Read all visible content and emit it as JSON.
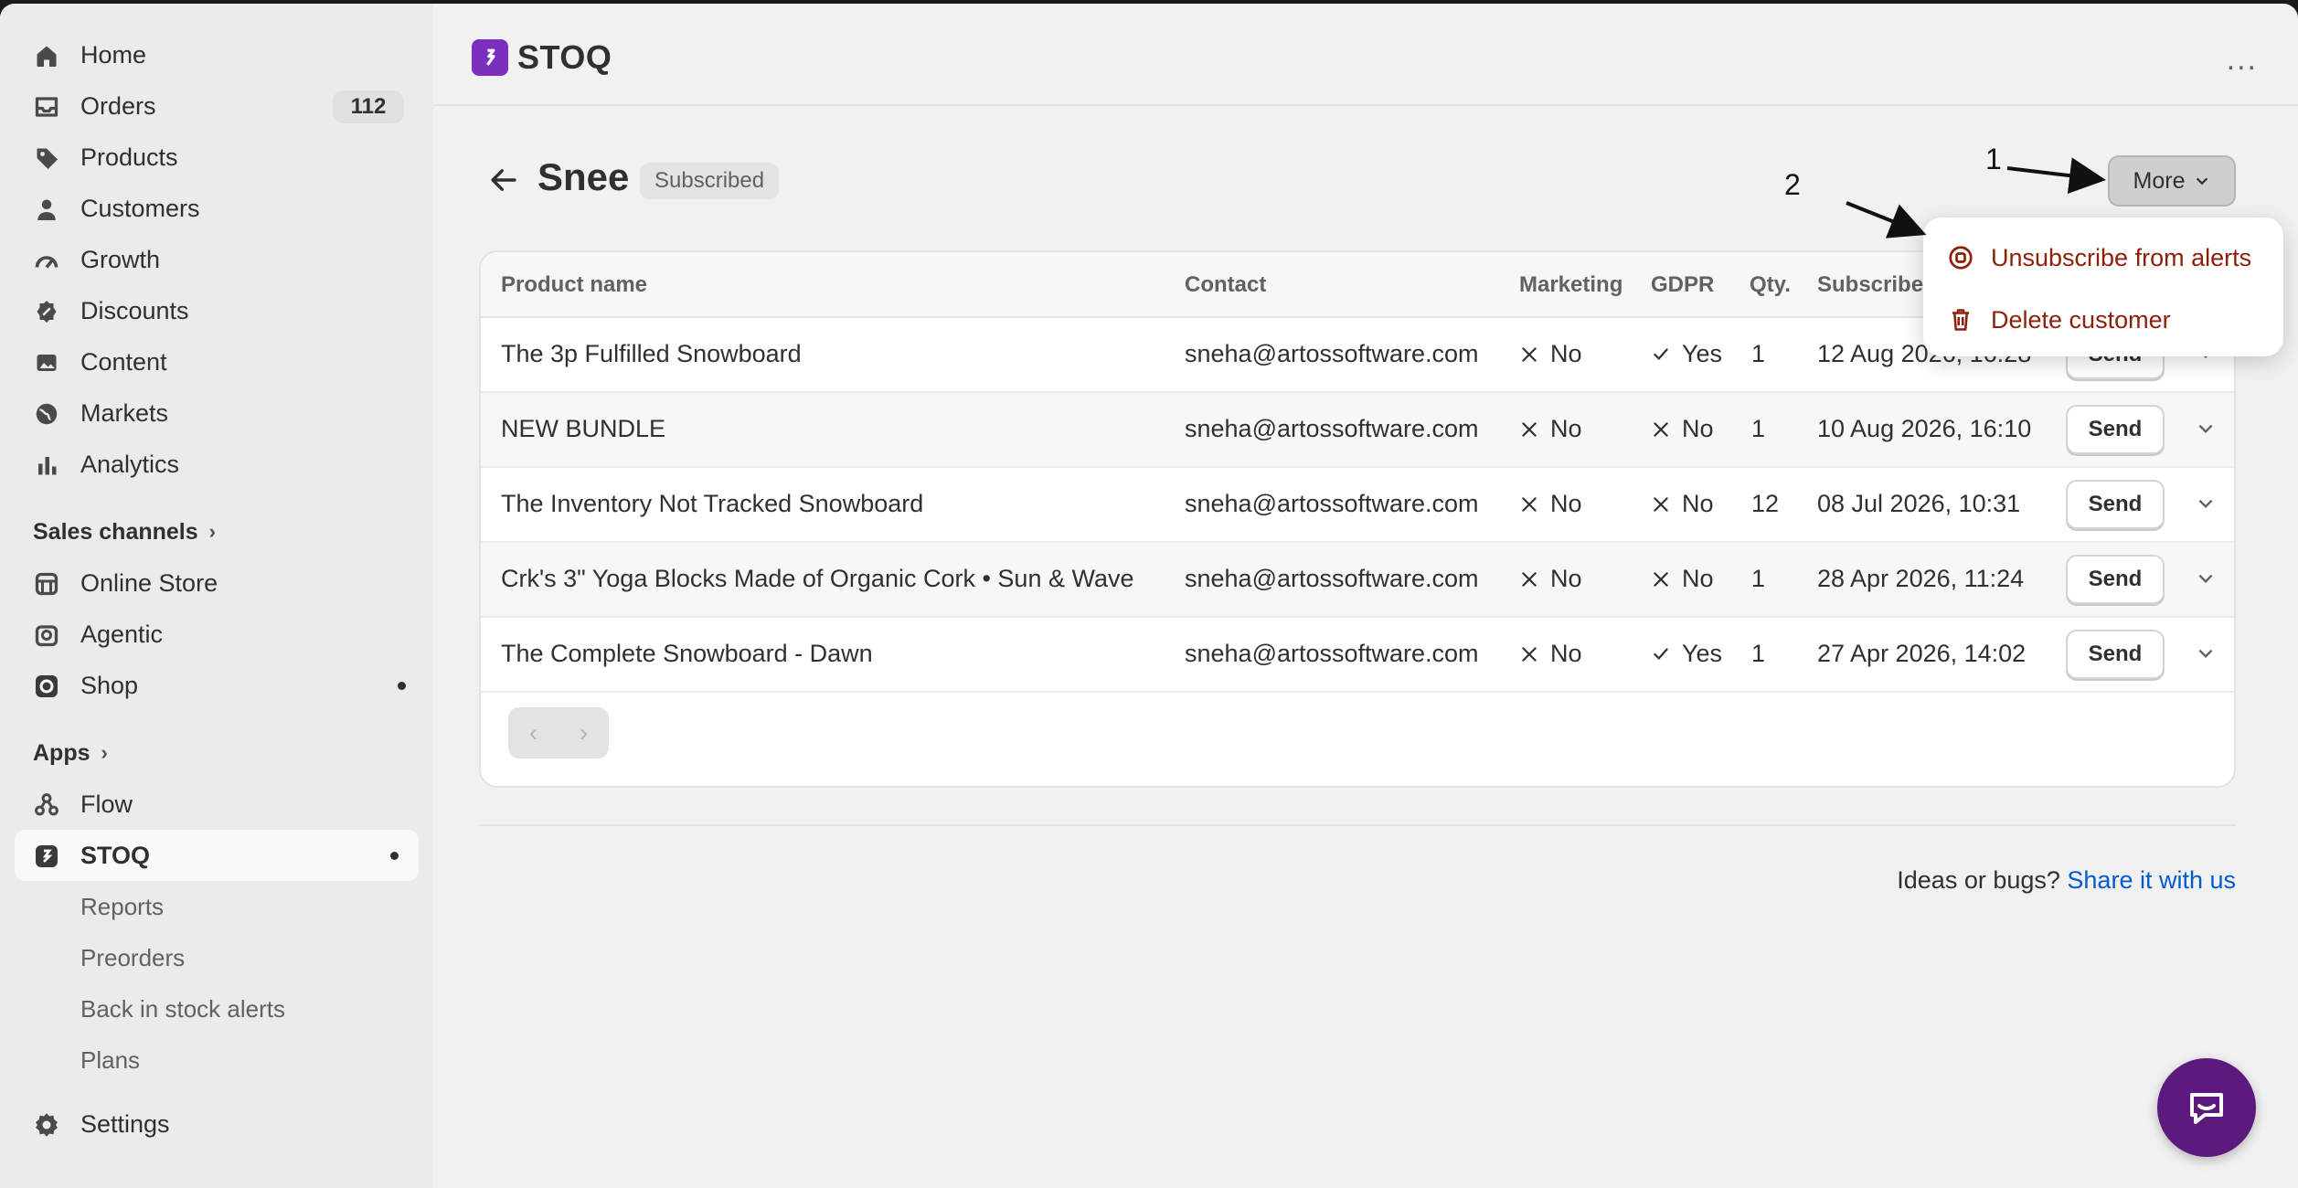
{
  "sidebar": {
    "main_items": [
      {
        "label": "Home",
        "icon": "home-icon"
      },
      {
        "label": "Orders",
        "icon": "inbox-icon",
        "badge": "112"
      },
      {
        "label": "Products",
        "icon": "tag-icon"
      },
      {
        "label": "Customers",
        "icon": "person-icon"
      },
      {
        "label": "Growth",
        "icon": "gauge-icon"
      },
      {
        "label": "Discounts",
        "icon": "discount-icon"
      },
      {
        "label": "Content",
        "icon": "image-icon"
      },
      {
        "label": "Markets",
        "icon": "globe-icon"
      },
      {
        "label": "Analytics",
        "icon": "bar-chart-icon"
      }
    ],
    "sales_channels_label": "Sales channels",
    "channels": [
      {
        "label": "Online Store",
        "icon": "store-icon"
      },
      {
        "label": "Agentic",
        "icon": "robot-icon"
      },
      {
        "label": "Shop",
        "icon": "shop-icon"
      }
    ],
    "apps_label": "Apps",
    "apps": [
      {
        "label": "Flow",
        "icon": "flow-icon"
      },
      {
        "label": "STOQ",
        "icon": "stoq-icon"
      }
    ],
    "stoq_subitems": [
      "Reports",
      "Preorders",
      "Back in stock alerts",
      "Plans"
    ],
    "settings_label": "Settings"
  },
  "topbar": {
    "brand": "STOQ",
    "more": "..."
  },
  "header": {
    "title": "Snee",
    "status_badge": "Subscribed",
    "more_button": "More"
  },
  "popover": {
    "items": [
      "Unsubscribe from alerts",
      "Delete customer"
    ]
  },
  "annotations": {
    "one": "1",
    "two": "2"
  },
  "table": {
    "columns": [
      "Product name",
      "Contact",
      "Marketing",
      "GDPR",
      "Qty.",
      "Subscribe"
    ],
    "send_label": "Send",
    "rows": [
      {
        "product": "The 3p Fulfilled Snowboard",
        "contact": "sneha@artossoftware.com",
        "marketing": "No",
        "gdpr": "Yes",
        "qty": "1",
        "date": "12 Aug 2026, 16:28"
      },
      {
        "product": "NEW BUNDLE",
        "contact": "sneha@artossoftware.com",
        "marketing": "No",
        "gdpr": "No",
        "qty": "1",
        "date": "10 Aug 2026, 16:10"
      },
      {
        "product": "The Inventory Not Tracked Snowboard",
        "contact": "sneha@artossoftware.com",
        "marketing": "No",
        "gdpr": "No",
        "qty": "12",
        "date": "08 Jul 2026, 10:31"
      },
      {
        "product": "Crk's 3\" Yoga Blocks Made of Organic Cork • Sun & Wave",
        "contact": "sneha@artossoftware.com",
        "marketing": "No",
        "gdpr": "No",
        "qty": "1",
        "date": "28 Apr 2026, 11:24"
      },
      {
        "product": "The Complete Snowboard - Dawn",
        "contact": "sneha@artossoftware.com",
        "marketing": "No",
        "gdpr": "Yes",
        "qty": "1",
        "date": "27 Apr 2026, 14:02"
      }
    ]
  },
  "footer": {
    "prompt": "Ideas or bugs?",
    "link": "Share it with us"
  },
  "colors": {
    "accent": "#7b2fbf",
    "danger": "#8e1f0b",
    "link": "#005bd3",
    "chat": "#5c1a7e"
  }
}
